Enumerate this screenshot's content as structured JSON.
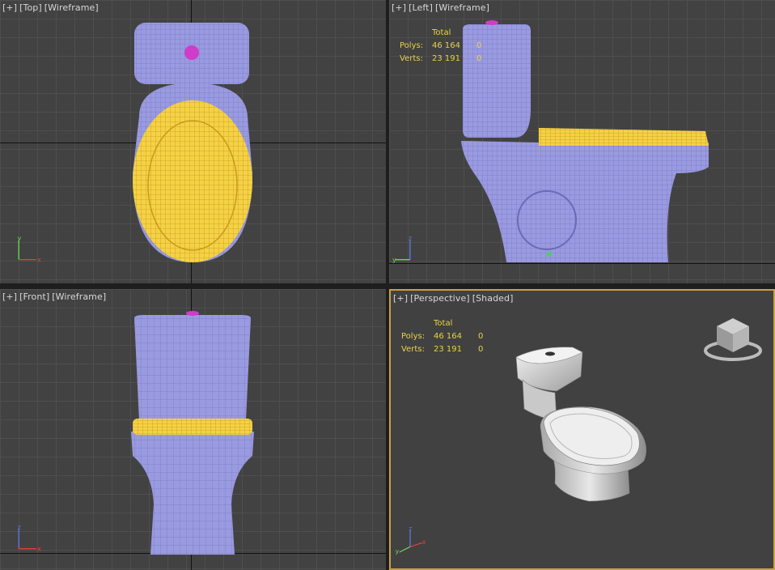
{
  "viewports": {
    "top": {
      "plus": "[+]",
      "name": "[Top]",
      "mode": "[Wireframe]"
    },
    "left": {
      "plus": "[+]",
      "name": "[Left]",
      "mode": "[Wireframe]"
    },
    "front": {
      "plus": "[+]",
      "name": "[Front]",
      "mode": "[Wireframe]"
    },
    "perspective": {
      "plus": "[+]",
      "name": "[Perspective]",
      "mode": "[Shaded]"
    }
  },
  "stats": {
    "header": "Total",
    "polys_label": "Polys:",
    "polys_total": "46 164",
    "polys_sel": "0",
    "verts_label": "Verts:",
    "verts_total": "23 191",
    "verts_sel": "0"
  },
  "axes": {
    "x": "x",
    "y": "y",
    "z": "z"
  },
  "colors": {
    "viewport_bg": "#424242",
    "grid": "#4e4e4e",
    "wire": "#9a9ae0",
    "seat": "#f5d245",
    "button": "#d03cc8",
    "stats_text": "#e8d24a",
    "active_border": "#c8a04a"
  }
}
